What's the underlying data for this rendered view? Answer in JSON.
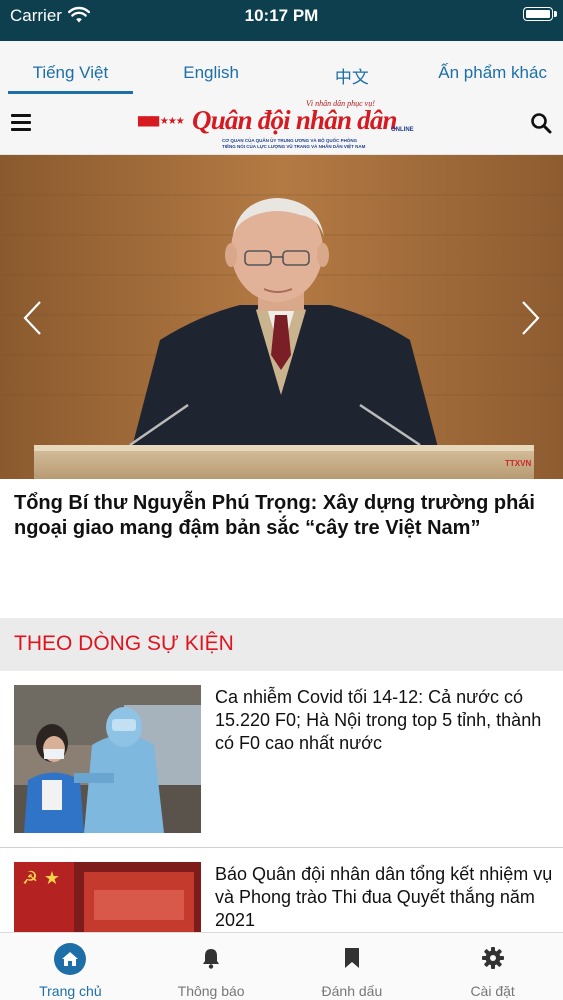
{
  "status_bar": {
    "carrier": "Carrier",
    "time": "10:17 PM"
  },
  "language_tabs": [
    {
      "label": "Tiếng Việt",
      "active": true
    },
    {
      "label": "English",
      "active": false
    },
    {
      "label": "中文",
      "active": false
    },
    {
      "label": "Ấn phẩm khác",
      "active": false
    }
  ],
  "brand": {
    "logo_title": "Quân đội nhân dân",
    "logo_tagline": "Vì nhân dân phục vụ!",
    "logo_suffix": "ONLINE",
    "logo_sub_line1": "CƠ QUAN CỦA QUÂN ỦY TRUNG ƯƠNG VÀ BỘ QUỐC PHÒNG",
    "logo_sub_line2": "TIẾNG NÓI CỦA LỰC LƯỢNG VŨ TRANG VÀ NHÂN DÂN VIỆT NAM"
  },
  "featured": {
    "headline": "Tổng Bí thư Nguyễn Phú Trọng: Xây dựng trường phái ngoại giao mang đậm bản sắc “cây tre Việt Nam”"
  },
  "section": {
    "title": "THEO DÒNG SỰ KIỆN"
  },
  "articles": [
    {
      "title": "Ca nhiễm Covid tối 14-12: Cả nước có 15.220 F0; Hà Nội trong top 5 tỉnh, thành có F0 cao nhất nước"
    },
    {
      "title": "Báo Quân đội nhân dân tổng kết nhiệm vụ và Phong trào Thi đua Quyết thắng năm 2021"
    }
  ],
  "tabbar": [
    {
      "label": "Trang chủ",
      "icon": "home-icon",
      "active": true
    },
    {
      "label": "Thông báo",
      "icon": "bell-icon",
      "active": false
    },
    {
      "label": "Đánh dấu",
      "icon": "bookmark-icon",
      "active": false
    },
    {
      "label": "Cài đặt",
      "icon": "gear-icon",
      "active": false
    }
  ],
  "colors": {
    "status_bar": "#0d3f4f",
    "accent": "#1e6fa8",
    "section_title": "#e0141e",
    "logo_red": "#d71920"
  }
}
